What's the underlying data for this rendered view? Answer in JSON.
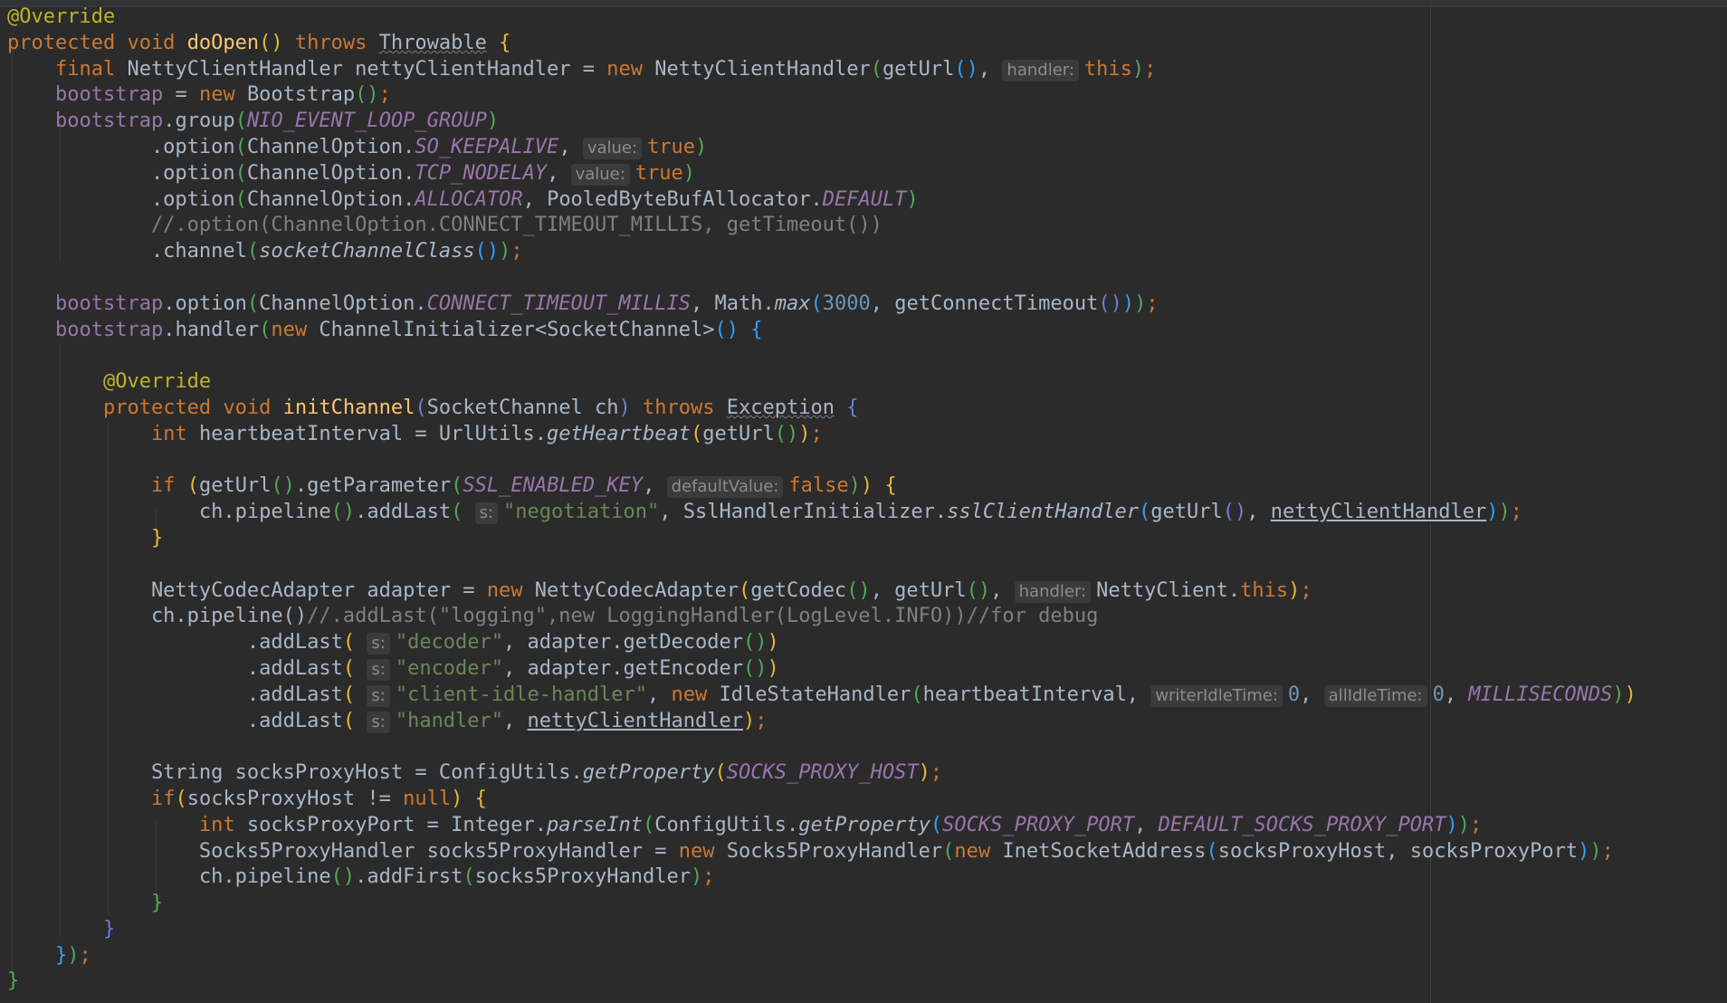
{
  "colors": {
    "background": "#2b2b2b",
    "default_text": "#a9b7c6",
    "keyword": "#cc7832",
    "annotation": "#bbb529",
    "method_declaration": "#ffc66d",
    "field": "#9876aa",
    "string": "#6a8759",
    "number": "#6897bb",
    "comment": "#808080",
    "param_hint_bg": "#3b3b3b",
    "rainbow_bracket_1": "#e8ba36",
    "rainbow_bracket_2": "#54a857",
    "rainbow_bracket_3": "#359ff4",
    "rainbow_bracket_4": "#6e7ed9"
  },
  "lines": [
    [
      [
        "ann",
        "@Override"
      ]
    ],
    [
      [
        "kw",
        "protected void "
      ],
      [
        "fn",
        "doOpen"
      ],
      [
        "p1",
        "()"
      ],
      [
        "t",
        " "
      ],
      [
        "kw",
        "throws"
      ],
      [
        "t",
        " "
      ],
      [
        "dep",
        "Throwable"
      ],
      [
        "t",
        " "
      ],
      [
        "p1",
        "{"
      ]
    ],
    [
      [
        "t",
        "    "
      ],
      [
        "kw",
        "final "
      ],
      [
        "t",
        "NettyClientHandler nettyClientHandler = "
      ],
      [
        "kw",
        "new "
      ],
      [
        "t",
        "NettyClientHandler"
      ],
      [
        "p2",
        "("
      ],
      [
        "t",
        "getUrl"
      ],
      [
        "p3",
        "()"
      ],
      [
        "t",
        ", "
      ],
      [
        "hint",
        "handler:"
      ],
      [
        "kw",
        "this"
      ],
      [
        "p2",
        ")"
      ],
      [
        "kw",
        ";"
      ]
    ],
    [
      [
        "t",
        "    "
      ],
      [
        "fld",
        "bootstrap"
      ],
      [
        "t",
        " = "
      ],
      [
        "kw",
        "new "
      ],
      [
        "t",
        "Bootstrap"
      ],
      [
        "p2",
        "()"
      ],
      [
        "kw",
        ";"
      ]
    ],
    [
      [
        "t",
        "    "
      ],
      [
        "fld",
        "bootstrap"
      ],
      [
        "t",
        ".group"
      ],
      [
        "p2",
        "("
      ],
      [
        "sfld",
        "NIO_EVENT_LOOP_GROUP"
      ],
      [
        "p2",
        ")"
      ]
    ],
    [
      [
        "t",
        "            .option"
      ],
      [
        "p2",
        "("
      ],
      [
        "t",
        "ChannelOption."
      ],
      [
        "sfld",
        "SO_KEEPALIVE"
      ],
      [
        "t",
        ", "
      ],
      [
        "hint",
        "value:"
      ],
      [
        "kw",
        "true"
      ],
      [
        "p2",
        ")"
      ]
    ],
    [
      [
        "t",
        "            .option"
      ],
      [
        "p2",
        "("
      ],
      [
        "t",
        "ChannelOption."
      ],
      [
        "sfld",
        "TCP_NODELAY"
      ],
      [
        "t",
        ", "
      ],
      [
        "hint",
        "value:"
      ],
      [
        "kw",
        "true"
      ],
      [
        "p2",
        ")"
      ]
    ],
    [
      [
        "t",
        "            .option"
      ],
      [
        "p2",
        "("
      ],
      [
        "t",
        "ChannelOption."
      ],
      [
        "sfld",
        "ALLOCATOR"
      ],
      [
        "t",
        ", PooledByteBufAllocator."
      ],
      [
        "sfld",
        "DEFAULT"
      ],
      [
        "p2",
        ")"
      ]
    ],
    [
      [
        "cmt",
        "            //.option(ChannelOption.CONNECT_TIMEOUT_MILLIS, getTimeout())"
      ]
    ],
    [
      [
        "t",
        "            .channel"
      ],
      [
        "p2",
        "("
      ],
      [
        "smeth",
        "socketChannelClass"
      ],
      [
        "p3",
        "()"
      ],
      [
        "p2",
        ")"
      ],
      [
        "kw",
        ";"
      ]
    ],
    [
      [
        "t",
        ""
      ]
    ],
    [
      [
        "t",
        "    "
      ],
      [
        "fld",
        "bootstrap"
      ],
      [
        "t",
        ".option"
      ],
      [
        "p2",
        "("
      ],
      [
        "t",
        "ChannelOption."
      ],
      [
        "sfld",
        "CONNECT_TIMEOUT_MILLIS"
      ],
      [
        "t",
        ", Math."
      ],
      [
        "smeth",
        "max"
      ],
      [
        "p3",
        "("
      ],
      [
        "num",
        "3000"
      ],
      [
        "t",
        ", getConnectTimeout"
      ],
      [
        "p4",
        "()"
      ],
      [
        "p3",
        ")"
      ],
      [
        "p2",
        ")"
      ],
      [
        "kw",
        ";"
      ]
    ],
    [
      [
        "t",
        "    "
      ],
      [
        "fld",
        "bootstrap"
      ],
      [
        "t",
        ".handler"
      ],
      [
        "p2",
        "("
      ],
      [
        "kw",
        "new "
      ],
      [
        "t",
        "ChannelInitializer<SocketChannel>"
      ],
      [
        "p3",
        "()"
      ],
      [
        "t",
        " "
      ],
      [
        "p3",
        "{"
      ]
    ],
    [
      [
        "t",
        ""
      ]
    ],
    [
      [
        "t",
        "        "
      ],
      [
        "ann",
        "@Override"
      ]
    ],
    [
      [
        "t",
        "        "
      ],
      [
        "kw",
        "protected void "
      ],
      [
        "fn",
        "initChannel"
      ],
      [
        "p4",
        "("
      ],
      [
        "t",
        "SocketChannel ch"
      ],
      [
        "p4",
        ")"
      ],
      [
        "t",
        " "
      ],
      [
        "kw",
        "throws"
      ],
      [
        "t",
        " "
      ],
      [
        "dep",
        "Exception"
      ],
      [
        "t",
        " "
      ],
      [
        "p4",
        "{"
      ]
    ],
    [
      [
        "t",
        "            "
      ],
      [
        "kw",
        "int "
      ],
      [
        "t",
        "heartbeatInterval = UrlUtils."
      ],
      [
        "smeth",
        "getHeartbeat"
      ],
      [
        "p1",
        "("
      ],
      [
        "t",
        "getUrl"
      ],
      [
        "p2",
        "()"
      ],
      [
        "p1",
        ")"
      ],
      [
        "kw",
        ";"
      ]
    ],
    [
      [
        "t",
        ""
      ]
    ],
    [
      [
        "t",
        "            "
      ],
      [
        "kw",
        "if "
      ],
      [
        "p1",
        "("
      ],
      [
        "t",
        "getUrl"
      ],
      [
        "p2",
        "()"
      ],
      [
        "t",
        ".getParameter"
      ],
      [
        "p2",
        "("
      ],
      [
        "sfld",
        "SSL_ENABLED_KEY"
      ],
      [
        "t",
        ", "
      ],
      [
        "hint",
        "defaultValue:"
      ],
      [
        "kw",
        "false"
      ],
      [
        "p2",
        ")"
      ],
      [
        "p1",
        ")"
      ],
      [
        "t",
        " "
      ],
      [
        "p1",
        "{"
      ]
    ],
    [
      [
        "t",
        "                ch.pipeline"
      ],
      [
        "p2",
        "()"
      ],
      [
        "t",
        ".addLast"
      ],
      [
        "p2",
        "("
      ],
      [
        "t",
        " "
      ],
      [
        "hint",
        "s:"
      ],
      [
        "str",
        "\"negotiation\""
      ],
      [
        "t",
        ", SslHandlerInitializer."
      ],
      [
        "smeth",
        "sslClientHandler"
      ],
      [
        "p3",
        "("
      ],
      [
        "t",
        "getUrl"
      ],
      [
        "p4",
        "()"
      ],
      [
        "t",
        ", "
      ],
      [
        "und",
        "nettyClientHandler"
      ],
      [
        "p3",
        ")"
      ],
      [
        "p2",
        ")"
      ],
      [
        "kw",
        ";"
      ]
    ],
    [
      [
        "t",
        "            "
      ],
      [
        "p1",
        "}"
      ]
    ],
    [
      [
        "t",
        ""
      ]
    ],
    [
      [
        "t",
        "            NettyCodecAdapter adapter = "
      ],
      [
        "kw",
        "new "
      ],
      [
        "t",
        "NettyCodecAdapter"
      ],
      [
        "p1",
        "("
      ],
      [
        "t",
        "getCodec"
      ],
      [
        "p2",
        "()"
      ],
      [
        "t",
        ", getUrl"
      ],
      [
        "p2",
        "()"
      ],
      [
        "t",
        ", "
      ],
      [
        "hint",
        "handler:"
      ],
      [
        "t",
        "NettyClient."
      ],
      [
        "kw",
        "this"
      ],
      [
        "p1",
        ")"
      ],
      [
        "kw",
        ";"
      ]
    ],
    [
      [
        "t",
        "            ch.pipeline()"
      ],
      [
        "cmt",
        "//.addLast(\"logging\",new LoggingHandler(LogLevel.INFO))//for debug"
      ]
    ],
    [
      [
        "t",
        "                    .addLast"
      ],
      [
        "p1",
        "("
      ],
      [
        "t",
        " "
      ],
      [
        "hint",
        "s:"
      ],
      [
        "str",
        "\"decoder\""
      ],
      [
        "t",
        ", adapter.getDecoder"
      ],
      [
        "p2",
        "()"
      ],
      [
        "p1",
        ")"
      ]
    ],
    [
      [
        "t",
        "                    .addLast"
      ],
      [
        "p1",
        "("
      ],
      [
        "t",
        " "
      ],
      [
        "hint",
        "s:"
      ],
      [
        "str",
        "\"encoder\""
      ],
      [
        "t",
        ", adapter.getEncoder"
      ],
      [
        "p2",
        "()"
      ],
      [
        "p1",
        ")"
      ]
    ],
    [
      [
        "t",
        "                    .addLast"
      ],
      [
        "p1",
        "("
      ],
      [
        "t",
        " "
      ],
      [
        "hint",
        "s:"
      ],
      [
        "str",
        "\"client-idle-handler\""
      ],
      [
        "t",
        ", "
      ],
      [
        "kw",
        "new "
      ],
      [
        "t",
        "IdleStateHandler"
      ],
      [
        "p2",
        "("
      ],
      [
        "t",
        "heartbeatInterval, "
      ],
      [
        "hint",
        "writerIdleTime:"
      ],
      [
        "num",
        "0"
      ],
      [
        "t",
        ", "
      ],
      [
        "hint",
        "allIdleTime:"
      ],
      [
        "num",
        "0"
      ],
      [
        "t",
        ", "
      ],
      [
        "sfld",
        "MILLISECONDS"
      ],
      [
        "p2",
        ")"
      ],
      [
        "p1",
        ")"
      ]
    ],
    [
      [
        "t",
        "                    .addLast"
      ],
      [
        "p1",
        "("
      ],
      [
        "t",
        " "
      ],
      [
        "hint",
        "s:"
      ],
      [
        "str",
        "\"handler\""
      ],
      [
        "t",
        ", "
      ],
      [
        "und",
        "nettyClientHandler"
      ],
      [
        "p1",
        ")"
      ],
      [
        "kw",
        ";"
      ]
    ],
    [
      [
        "t",
        ""
      ]
    ],
    [
      [
        "t",
        "            String socksProxyHost = ConfigUtils."
      ],
      [
        "smeth",
        "getProperty"
      ],
      [
        "p1",
        "("
      ],
      [
        "sfld",
        "SOCKS_PROXY_HOST"
      ],
      [
        "p1",
        ")"
      ],
      [
        "kw",
        ";"
      ]
    ],
    [
      [
        "t",
        "            "
      ],
      [
        "kw",
        "if"
      ],
      [
        "p1",
        "("
      ],
      [
        "t",
        "socksProxyHost != "
      ],
      [
        "kw",
        "null"
      ],
      [
        "p1",
        ")"
      ],
      [
        "t",
        " "
      ],
      [
        "p1",
        "{"
      ]
    ],
    [
      [
        "t",
        "                "
      ],
      [
        "kw",
        "int "
      ],
      [
        "t",
        "socksProxyPort = Integer."
      ],
      [
        "smeth",
        "parseInt"
      ],
      [
        "p2",
        "("
      ],
      [
        "t",
        "ConfigUtils."
      ],
      [
        "smeth",
        "getProperty"
      ],
      [
        "p3",
        "("
      ],
      [
        "sfld",
        "SOCKS_PROXY_PORT"
      ],
      [
        "t",
        ", "
      ],
      [
        "sfld",
        "DEFAULT_SOCKS_PROXY_PORT"
      ],
      [
        "p3",
        ")"
      ],
      [
        "p2",
        ")"
      ],
      [
        "kw",
        ";"
      ]
    ],
    [
      [
        "t",
        "                Socks5ProxyHandler socks5ProxyHandler = "
      ],
      [
        "kw",
        "new "
      ],
      [
        "t",
        "Socks5ProxyHandler"
      ],
      [
        "p2",
        "("
      ],
      [
        "kw",
        "new "
      ],
      [
        "t",
        "InetSocketAddress"
      ],
      [
        "p3",
        "("
      ],
      [
        "t",
        "socksProxyHost, socksProxyPort"
      ],
      [
        "p3",
        ")"
      ],
      [
        "p2",
        ")"
      ],
      [
        "kw",
        ";"
      ]
    ],
    [
      [
        "t",
        "                ch.pipeline"
      ],
      [
        "p2",
        "()"
      ],
      [
        "t",
        ".addFirst"
      ],
      [
        "p2",
        "("
      ],
      [
        "t",
        "socks5ProxyHandler"
      ],
      [
        "p2",
        ")"
      ],
      [
        "kw",
        ";"
      ]
    ],
    [
      [
        "t",
        "            "
      ],
      [
        "p2",
        "}"
      ]
    ],
    [
      [
        "t",
        "        "
      ],
      [
        "p4",
        "}"
      ]
    ],
    [
      [
        "t",
        "    "
      ],
      [
        "p3",
        "}"
      ],
      [
        "p2",
        ")"
      ],
      [
        "kw",
        ";"
      ]
    ],
    [
      [
        "p2",
        "}"
      ]
    ]
  ]
}
